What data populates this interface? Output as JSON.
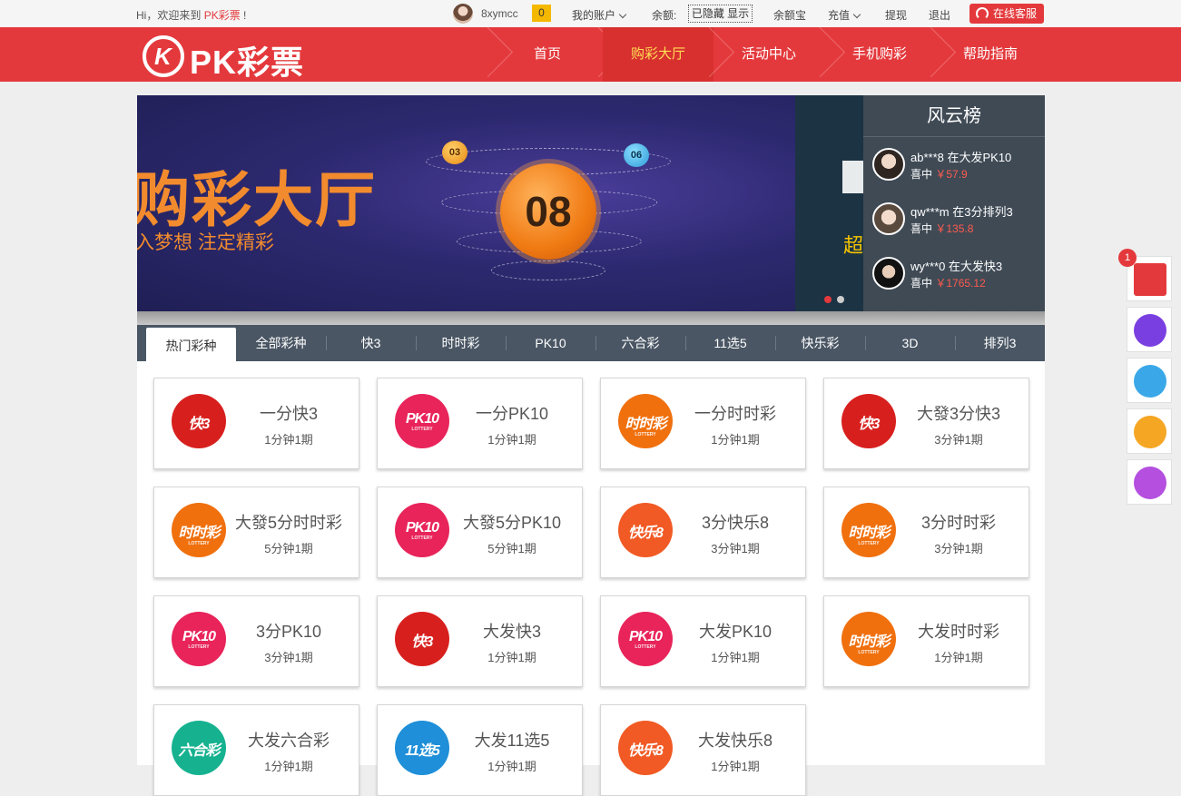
{
  "topbar": {
    "greeting": "Hi，欢迎来到",
    "brand": "PK彩票",
    "greeting_end": " !",
    "username": "8xymcc",
    "msg_count": "0",
    "my_account": "我的账户",
    "balance_label": "余额:",
    "balance_hidden": "已隐藏 显示",
    "yuebao": "余额宝",
    "recharge": "充值",
    "withdraw": "提现",
    "logout": "退出",
    "service": "在线客服"
  },
  "header": {
    "logo_mark": "K",
    "logo_text": "PK彩票",
    "nav": [
      {
        "label": "首页",
        "active": false
      },
      {
        "label": "购彩大厅",
        "active": true
      },
      {
        "label": "活动中心",
        "active": false
      },
      {
        "label": "手机购彩",
        "active": false
      },
      {
        "label": "帮助指南",
        "active": false
      }
    ]
  },
  "banner": {
    "title": "购彩大厅",
    "subtitle": "入梦想  注定精彩",
    "main_ball": "08",
    "ball_left": "03",
    "ball_right": "06",
    "side_text": "超",
    "dot_active_color": "#e4393c",
    "dot_color": "#cccccc"
  },
  "rank": {
    "title": "风云榜",
    "rows": [
      {
        "who": "ab***8 在大发PK10",
        "won": "喜中",
        "amount": "￥57.9"
      },
      {
        "who": "qw***m 在3分排列3",
        "won": "喜中",
        "amount": "￥135.8"
      },
      {
        "who": "wy***0 在大发快3",
        "won": "喜中",
        "amount": "￥1765.12"
      }
    ]
  },
  "tabs": [
    "热门彩种",
    "全部彩种",
    "快3",
    "时时彩",
    "PK10",
    "六合彩",
    "11选5",
    "快乐彩",
    "3D",
    "排列3"
  ],
  "games": [
    {
      "name": "一分快3",
      "period": "1分钟1期",
      "icon": "kuai3-icon",
      "glyph": "快3",
      "sub": "",
      "color": "#d7201e"
    },
    {
      "name": "一分PK10",
      "period": "1分钟1期",
      "icon": "pk10-icon",
      "glyph": "PK10",
      "sub": "LOTTERY",
      "color": "#e8245a"
    },
    {
      "name": "一分时时彩",
      "period": "1分钟1期",
      "icon": "shishicai-icon",
      "glyph": "时时彩",
      "sub": "LOTTERY",
      "color": "#f0700e"
    },
    {
      "name": "大發3分快3",
      "period": "3分钟1期",
      "icon": "kuai3-icon",
      "glyph": "快3",
      "sub": "",
      "color": "#d7201e"
    },
    {
      "name": "大發5分时时彩",
      "period": "5分钟1期",
      "icon": "shishicai-icon",
      "glyph": "时时彩",
      "sub": "LOTTERY",
      "color": "#f0700e"
    },
    {
      "name": "大發5分PK10",
      "period": "5分钟1期",
      "icon": "pk10-icon",
      "glyph": "PK10",
      "sub": "LOTTERY",
      "color": "#e8245a"
    },
    {
      "name": "3分快乐8",
      "period": "3分钟1期",
      "icon": "kuaile8-icon",
      "glyph": "快乐8",
      "sub": "",
      "color": "#f15a24"
    },
    {
      "name": "3分时时彩",
      "period": "3分钟1期",
      "icon": "shishicai-icon",
      "glyph": "时时彩",
      "sub": "LOTTERY",
      "color": "#f0700e"
    },
    {
      "name": "3分PK10",
      "period": "3分钟1期",
      "icon": "pk10-icon",
      "glyph": "PK10",
      "sub": "LOTTERY",
      "color": "#e8245a"
    },
    {
      "name": "大发快3",
      "period": "1分钟1期",
      "icon": "kuai3-icon",
      "glyph": "快3",
      "sub": "",
      "color": "#d7201e"
    },
    {
      "name": "大发PK10",
      "period": "1分钟1期",
      "icon": "pk10-icon",
      "glyph": "PK10",
      "sub": "LOTTERY",
      "color": "#e8245a"
    },
    {
      "name": "大发时时彩",
      "period": "1分钟1期",
      "icon": "shishicai-icon",
      "glyph": "时时彩",
      "sub": "LOTTERY",
      "color": "#f0700e"
    },
    {
      "name": "大发六合彩",
      "period": "1分钟1期",
      "icon": "liuhecai-icon",
      "glyph": "六合彩",
      "sub": "",
      "color": "#16b290"
    },
    {
      "name": "大发11选5",
      "period": "1分钟1期",
      "icon": "11xuan5-icon",
      "glyph": "11选5",
      "sub": "",
      "color": "#1e8fd8"
    },
    {
      "name": "大发快乐8",
      "period": "1分钟1期",
      "icon": "kuaile8-icon",
      "glyph": "快乐8",
      "sub": "",
      "color": "#f15a24"
    }
  ],
  "floatbar": {
    "redpacket_count": "1",
    "items": [
      {
        "icon": "red-packet-icon",
        "color": "#e4393c"
      },
      {
        "icon": "w-app-icon",
        "color": "#7a3fe0"
      },
      {
        "icon": "changlong-icon",
        "color": "#3aa8e8"
      },
      {
        "icon": "group-chat-icon",
        "color": "#f5a623"
      },
      {
        "icon": "support-face-icon",
        "color": "#b44fe0"
      }
    ]
  }
}
